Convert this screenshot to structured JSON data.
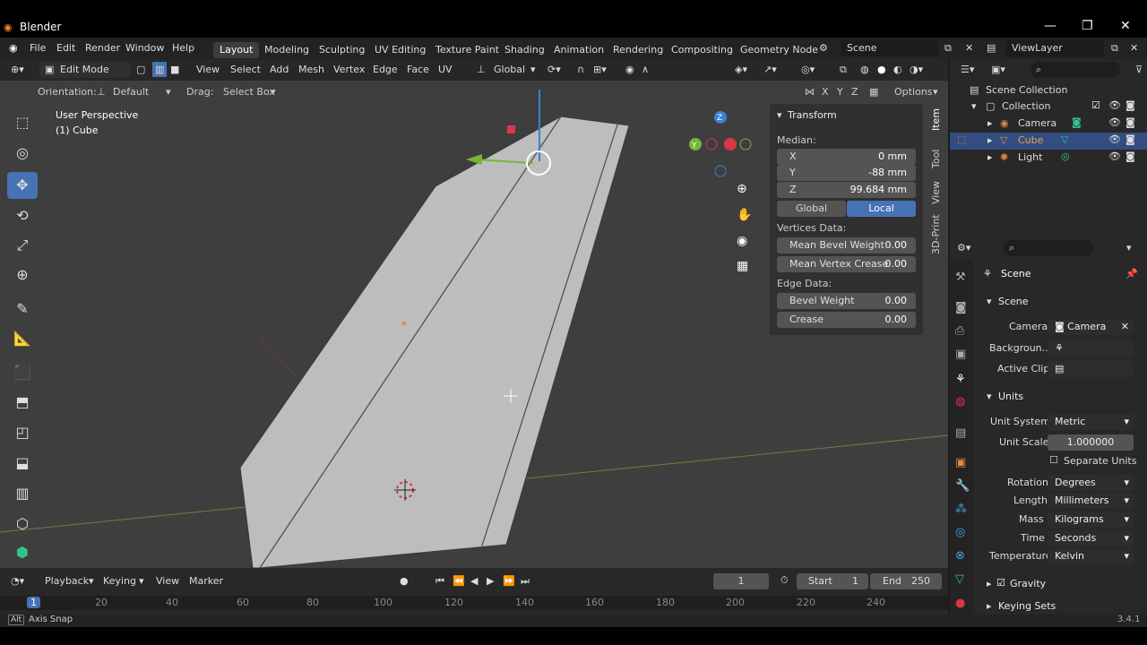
{
  "titlebar": {
    "title": "Blender",
    "minimize": "—",
    "restore": "❐",
    "close": "✕"
  },
  "menu": {
    "items": [
      "File",
      "Edit",
      "Render",
      "Window",
      "Help"
    ]
  },
  "workspaces": [
    "Layout",
    "Modeling",
    "Sculpting",
    "UV Editing",
    "Texture Paint",
    "Shading",
    "Animation",
    "Rendering",
    "Compositing",
    "Geometry Node"
  ],
  "scene_selector": "Scene",
  "viewlayer_selector": "ViewLayer",
  "header": {
    "mode": "Edit Mode",
    "menus": [
      "View",
      "Select",
      "Add",
      "Mesh",
      "Vertex",
      "Edge",
      "Face",
      "UV"
    ],
    "transform_orientation": "Global"
  },
  "tool_header": {
    "orientation_label": "Orientation:",
    "orientation_value": "Default",
    "drag_label": "Drag:",
    "drag_value": "Select Box",
    "axes": [
      "X",
      "Y",
      "Z"
    ],
    "options": "Options"
  },
  "viewport": {
    "perspective": "User Perspective",
    "object": "(1) Cube",
    "gizmo_axes": [
      "X",
      "Y",
      "Z"
    ]
  },
  "npanel": {
    "header": "Transform",
    "median_label": "Median:",
    "median": [
      {
        "axis": "X",
        "value": "0 mm"
      },
      {
        "axis": "Y",
        "value": "-88 mm"
      },
      {
        "axis": "Z",
        "value": "99.684 mm"
      }
    ],
    "space_global": "Global",
    "space_local": "Local",
    "vertices_data_label": "Vertices Data:",
    "vertices_data": [
      {
        "label": "Mean Bevel Weight",
        "value": "0.00"
      },
      {
        "label": "Mean Vertex Crease",
        "value": "0.00"
      }
    ],
    "edge_data_label": "Edge Data:",
    "edge_data": [
      {
        "label": "Bevel Weight",
        "value": "0.00"
      },
      {
        "label": "Crease",
        "value": "0.00"
      }
    ],
    "side_tabs": [
      "Item",
      "Tool",
      "View",
      "3D-Print"
    ]
  },
  "outliner": {
    "root": "Scene Collection",
    "collection": "Collection",
    "items": [
      {
        "name": "Camera",
        "color": "#e0893f"
      },
      {
        "name": "Cube",
        "color": "#e0893f"
      },
      {
        "name": "Light",
        "color": "#e0893f"
      }
    ]
  },
  "properties": {
    "breadcrumb": "Scene",
    "scene_panel": "Scene",
    "camera_label": "Camera",
    "camera_value": "Camera",
    "background_label": "Backgroun...",
    "active_clip_label": "Active Clip",
    "units_panel": "Units",
    "unit_system_label": "Unit System",
    "unit_system_value": "Metric",
    "unit_scale_label": "Unit Scale",
    "unit_scale_value": "1.000000",
    "separate_units": "Separate Units",
    "rotation_label": "Rotation",
    "rotation_value": "Degrees",
    "length_label": "Length",
    "length_value": "Millimeters",
    "mass_label": "Mass",
    "mass_value": "Kilograms",
    "time_label": "Time",
    "time_value": "Seconds",
    "temperature_label": "Temperature",
    "temperature_value": "Kelvin",
    "gravity_panel": "Gravity",
    "keying_sets_panel": "Keying Sets"
  },
  "timeline": {
    "menus": [
      "Playback",
      "Keying",
      "View",
      "Marker"
    ],
    "current_frame": "1",
    "start_label": "Start",
    "start_value": "1",
    "end_label": "End",
    "end_value": "250",
    "ruler": [
      "1",
      "20",
      "40",
      "60",
      "80",
      "100",
      "120",
      "140",
      "160",
      "180",
      "200",
      "220",
      "240"
    ]
  },
  "statusbar": {
    "key": "Alt",
    "text": "Axis Snap",
    "version": "3.4.1"
  },
  "colors": {
    "accent": "#4772b3",
    "mesh": "#bdbdbd",
    "viewport_bg": "#3e3e3e",
    "x_axis": "#d9364c",
    "y_axis": "#7ab33a",
    "z_axis": "#3b7fd6"
  }
}
